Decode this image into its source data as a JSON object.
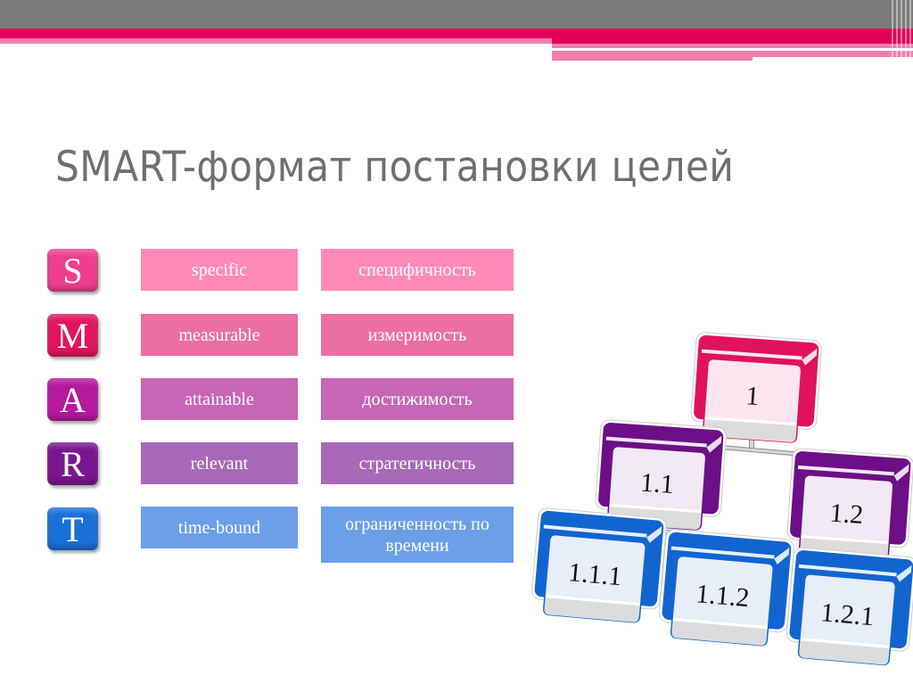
{
  "slide": {
    "title": "SMART-формат постановки целей"
  },
  "colors": {
    "band_gray": "#7b7b7b",
    "band_red": "#e2005a",
    "band_pink": "#f07fab",
    "title_text": "#6f6f6f"
  },
  "smart_rows": [
    {
      "letter": "S",
      "english": "specific",
      "russian": "специфичность",
      "tile_color": "#ee3f8e",
      "box_color": "#ff8ab8"
    },
    {
      "letter": "M",
      "english": "measurable",
      "russian": "измеримость",
      "tile_color": "#e2145e",
      "box_color": "#ec6fa1"
    },
    {
      "letter": "A",
      "english": "attainable",
      "russian": "достижимость",
      "tile_color": "#b4199e",
      "box_color": "#c866b6"
    },
    {
      "letter": "R",
      "english": "relevant",
      "russian": "стратегичность",
      "tile_color": "#7a168f",
      "box_color": "#a86ab8"
    },
    {
      "letter": "T",
      "english": "time-bound",
      "russian": "ограниченность по времени",
      "tile_color": "#1a6fd8",
      "box_color": "#6b9fe8"
    }
  ],
  "hierarchy": {
    "nodes": [
      {
        "id": "1",
        "label": "1",
        "level": 0,
        "color": "#e0125d",
        "face": "#fbe6ef"
      },
      {
        "id": "1.1",
        "label": "1.1",
        "level": 1,
        "color": "#6d0f86",
        "face": "#f1e9f3"
      },
      {
        "id": "1.2",
        "label": "1.2",
        "level": 1,
        "color": "#6d0f86",
        "face": "#f1e9f3"
      },
      {
        "id": "1.1.1",
        "label": "1.1.1",
        "level": 2,
        "color": "#1265cf",
        "face": "#e8eef8"
      },
      {
        "id": "1.1.2",
        "label": "1.1.2",
        "level": 2,
        "color": "#1265cf",
        "face": "#e8eef8"
      },
      {
        "id": "1.2.1",
        "label": "1.2.1",
        "level": 2,
        "color": "#1265cf",
        "face": "#e8eef8"
      }
    ]
  }
}
